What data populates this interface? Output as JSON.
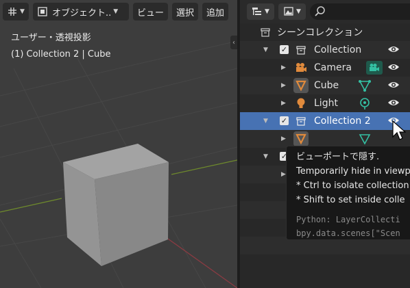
{
  "viewport": {
    "header": {
      "mode_label": "オブジェクト..",
      "menu_view": "ビュー",
      "menu_select": "選択",
      "menu_add": "追加"
    },
    "overlay": {
      "view_name": "ユーザー・透視投影",
      "object_info": "(1) Collection 2 | Cube"
    }
  },
  "outliner": {
    "rows": {
      "scene_collection": "シーンコレクション",
      "collection": "Collection",
      "camera": "Camera",
      "cube": "Cube",
      "light": "Light",
      "collection2": "Collection 2"
    }
  },
  "tooltip": {
    "title": "ビューポートで隠す.",
    "line1": "Temporarily hide in viewp",
    "line2": "* Ctrl to isolate collection",
    "line3": "* Shift to set inside colle",
    "python1": "Python: LayerCollecti",
    "python2": "bpy.data.scenes[\"Scen"
  },
  "colors": {
    "selection": "#4772b3",
    "object_orange": "#e08a3c",
    "data_green": "#34c1a4"
  }
}
